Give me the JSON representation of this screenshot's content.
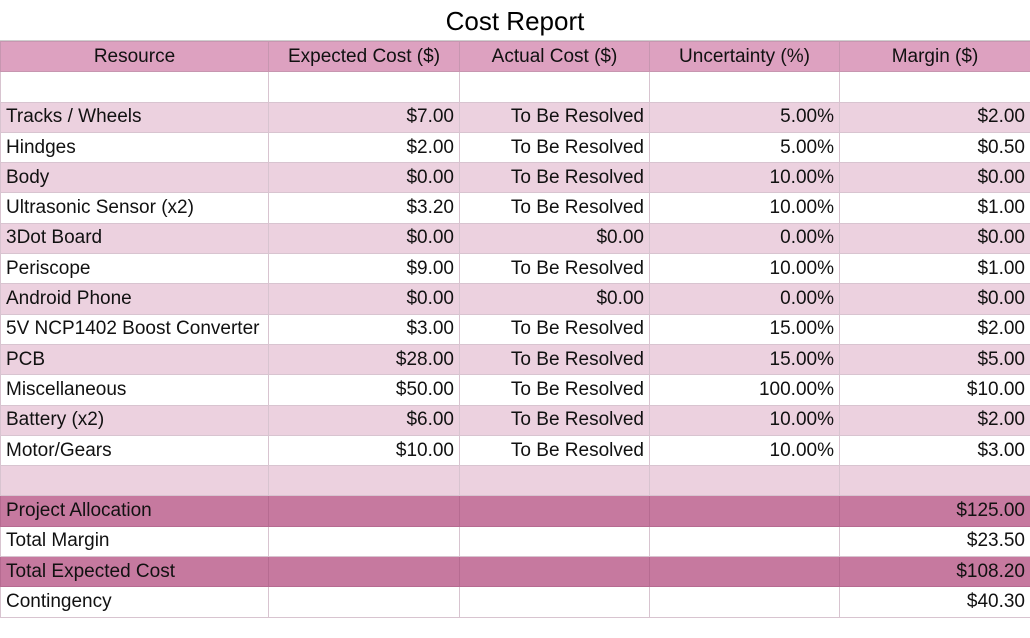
{
  "title": "Cost Report",
  "headers": [
    "Resource",
    "Expected Cost ($)",
    "Actual Cost ($)",
    "Uncertainty (%)",
    "Margin ($)"
  ],
  "rows": [
    {
      "resource": "Tracks / Wheels",
      "expected": "$7.00",
      "actual": "To Be Resolved",
      "uncertainty": "5.00%",
      "margin": "$2.00"
    },
    {
      "resource": "Hindges",
      "expected": "$2.00",
      "actual": "To Be Resolved",
      "uncertainty": "5.00%",
      "margin": "$0.50"
    },
    {
      "resource": "Body",
      "expected": "$0.00",
      "actual": "To Be Resolved",
      "uncertainty": "10.00%",
      "margin": "$0.00"
    },
    {
      "resource": "Ultrasonic Sensor (x2)",
      "expected": "$3.20",
      "actual": "To Be Resolved",
      "uncertainty": "10.00%",
      "margin": "$1.00"
    },
    {
      "resource": "3Dot Board",
      "expected": "$0.00",
      "actual": "$0.00",
      "uncertainty": "0.00%",
      "margin": "$0.00"
    },
    {
      "resource": "Periscope",
      "expected": "$9.00",
      "actual": "To Be Resolved",
      "uncertainty": "10.00%",
      "margin": "$1.00"
    },
    {
      "resource": "Android Phone",
      "expected": "$0.00",
      "actual": "$0.00",
      "uncertainty": "0.00%",
      "margin": "$0.00"
    },
    {
      "resource": "5V NCP1402 Boost Converter",
      "expected": "$3.00",
      "actual": "To Be Resolved",
      "uncertainty": "15.00%",
      "margin": "$2.00"
    },
    {
      "resource": "PCB",
      "expected": "$28.00",
      "actual": "To Be Resolved",
      "uncertainty": "15.00%",
      "margin": "$5.00"
    },
    {
      "resource": "Miscellaneous",
      "expected": "$50.00",
      "actual": "To Be Resolved",
      "uncertainty": "100.00%",
      "margin": "$10.00"
    },
    {
      "resource": "Battery (x2)",
      "expected": "$6.00",
      "actual": "To Be Resolved",
      "uncertainty": "10.00%",
      "margin": "$2.00"
    },
    {
      "resource": "Motor/Gears",
      "expected": "$10.00",
      "actual": "To Be Resolved",
      "uncertainty": "10.00%",
      "margin": "$3.00"
    }
  ],
  "summary": [
    {
      "label": "Project Allocation",
      "value": "$125.00"
    },
    {
      "label": "Total Margin",
      "value": "$23.50"
    },
    {
      "label": "Total Expected Cost",
      "value": "$108.20"
    },
    {
      "label": "Contingency",
      "value": "$40.30"
    }
  ],
  "colors": {
    "header": "#dda1c0",
    "band_light": "#ecd1df",
    "band_dark": "#c6799f"
  }
}
